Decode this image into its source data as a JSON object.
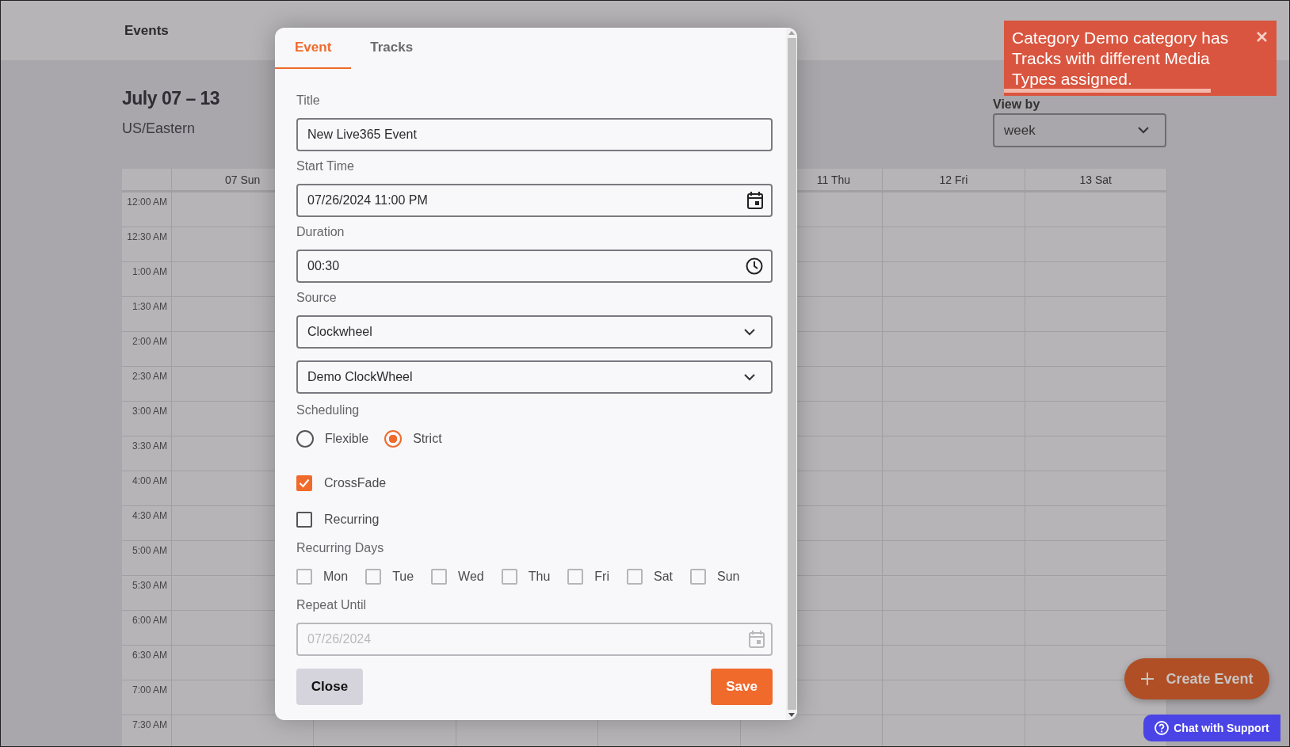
{
  "header": {
    "title": "Events"
  },
  "week": {
    "range": "July 07 – 13",
    "timezone": "US/Eastern"
  },
  "view_by": {
    "label": "View by",
    "value": "week"
  },
  "calendar": {
    "days_before_dialog": [
      {
        "label": "07 Sun"
      }
    ],
    "days_after_dialog": [
      {
        "label": "11 Thu"
      },
      {
        "label": "12 Fri"
      },
      {
        "label": "13 Sat"
      }
    ],
    "times": [
      "12:00 AM",
      "12:30 AM",
      "1:00 AM",
      "1:30 AM",
      "2:00 AM",
      "2:30 AM",
      "3:00 AM",
      "3:30 AM",
      "4:00 AM",
      "4:30 AM",
      "5:00 AM",
      "5:30 AM",
      "6:00 AM",
      "6:30 AM",
      "7:00 AM",
      "7:30 AM"
    ]
  },
  "dialog": {
    "tabs": [
      {
        "label": "Event",
        "selected": true
      },
      {
        "label": "Tracks",
        "selected": false
      }
    ],
    "fields": [
      {
        "kind": "text",
        "label": "Title",
        "value": "New Live365 Event"
      },
      {
        "kind": "datetime",
        "label": "Start Time",
        "value": "07/26/2024 11:00 PM"
      },
      {
        "kind": "time",
        "label": "Duration",
        "value": "00:30"
      },
      {
        "kind": "select",
        "label": "Source",
        "value": "Clockwheel"
      },
      {
        "kind": "select",
        "value": "Demo ClockWheel"
      }
    ],
    "scheduling": {
      "label": "Scheduling",
      "options": [
        {
          "label": "Flexible",
          "selected": false
        },
        {
          "label": "Strict",
          "selected": true
        }
      ]
    },
    "options": [
      {
        "label": "CrossFade",
        "checked": true
      },
      {
        "label": "Recurring",
        "checked": false
      }
    ],
    "recurring_days": {
      "label": "Recurring Days",
      "days": [
        {
          "label": "Mon",
          "checked": false
        },
        {
          "label": "Tue",
          "checked": false
        },
        {
          "label": "Wed",
          "checked": false
        },
        {
          "label": "Thu",
          "checked": false
        },
        {
          "label": "Fri",
          "checked": false
        },
        {
          "label": "Sat",
          "checked": false
        },
        {
          "label": "Sun",
          "checked": false
        }
      ]
    },
    "repeat_until": {
      "label": "Repeat Until",
      "placeholder": "07/26/2024",
      "disabled": true
    },
    "buttons": [
      {
        "kind": "secondary",
        "label": "Close"
      },
      {
        "kind": "primary",
        "label": "Save"
      }
    ]
  },
  "toast": {
    "message": "Category Demo category has Tracks with different Media Types assigned.",
    "level": 0.76
  },
  "create_button": {
    "label": "Create Event"
  },
  "chat_button": {
    "label": "Chat with Support"
  }
}
